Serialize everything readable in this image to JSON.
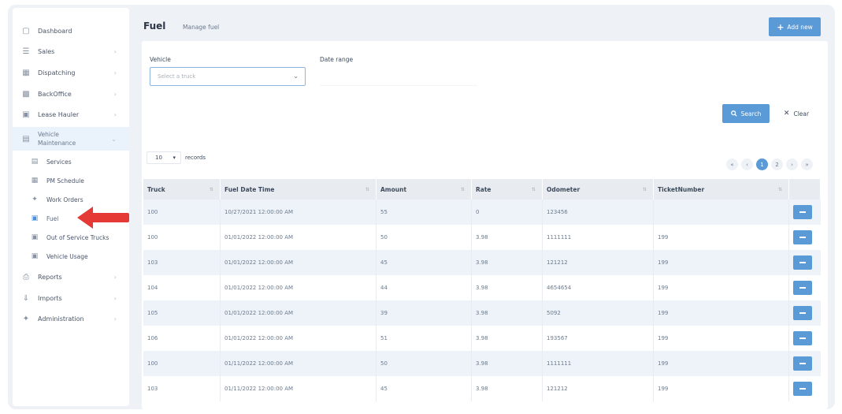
{
  "sidebar": {
    "items": [
      {
        "label": "Dashboard",
        "icon": "monitor-icon"
      },
      {
        "label": "Sales",
        "icon": "list-icon"
      },
      {
        "label": "Dispatching",
        "icon": "calendar-icon"
      },
      {
        "label": "BackOffice",
        "icon": "briefcase-icon"
      },
      {
        "label": "Lease Hauler",
        "icon": "truck-icon"
      },
      {
        "label": "Vehicle Maintenance",
        "icon": "document-icon"
      },
      {
        "label": "Reports",
        "icon": "printer-icon"
      },
      {
        "label": "Imports",
        "icon": "import-icon"
      },
      {
        "label": "Administration",
        "icon": "wrench-icon"
      }
    ],
    "sub_items": [
      {
        "label": "Services",
        "icon": "card-icon"
      },
      {
        "label": "PM Schedule",
        "icon": "calendar-icon"
      },
      {
        "label": "Work Orders",
        "icon": "wrench-icon"
      },
      {
        "label": "Fuel",
        "icon": "fuel-icon"
      },
      {
        "label": "Out of Service Trucks",
        "icon": "truck-icon"
      },
      {
        "label": "Vehicle Usage",
        "icon": "truck-icon"
      }
    ]
  },
  "header": {
    "title": "Fuel",
    "subtitle": "Manage fuel",
    "add_label": "Add new"
  },
  "filters": {
    "vehicle_label": "Vehicle",
    "vehicle_placeholder": "Select a truck",
    "date_label": "Date range",
    "search_label": "Search",
    "clear_label": "Clear"
  },
  "table_controls": {
    "page_size": "10",
    "records_label": "records",
    "pages": [
      "1",
      "2"
    ]
  },
  "table": {
    "columns": [
      "Truck",
      "Fuel Date Time",
      "Amount",
      "Rate",
      "Odometer",
      "TicketNumber"
    ],
    "rows": [
      [
        "100",
        "10/27/2021 12:00:00 AM",
        "55",
        "0",
        "123456",
        ""
      ],
      [
        "100",
        "01/01/2022 12:00:00 AM",
        "50",
        "3.98",
        "1111111",
        "199"
      ],
      [
        "103",
        "01/01/2022 12:00:00 AM",
        "45",
        "3.98",
        "121212",
        "199"
      ],
      [
        "104",
        "01/01/2022 12:00:00 AM",
        "44",
        "3.98",
        "4654654",
        "199"
      ],
      [
        "105",
        "01/01/2022 12:00:00 AM",
        "39",
        "3.98",
        "5092",
        "199"
      ],
      [
        "106",
        "01/01/2022 12:00:00 AM",
        "51",
        "3.98",
        "193567",
        "199"
      ],
      [
        "100",
        "01/11/2022 12:00:00 AM",
        "50",
        "3.98",
        "1111111",
        "199"
      ],
      [
        "103",
        "01/11/2022 12:00:00 AM",
        "45",
        "3.98",
        "121212",
        "199"
      ]
    ]
  },
  "colors": {
    "accent": "#5a9ad6",
    "arrow": "#e53935"
  }
}
